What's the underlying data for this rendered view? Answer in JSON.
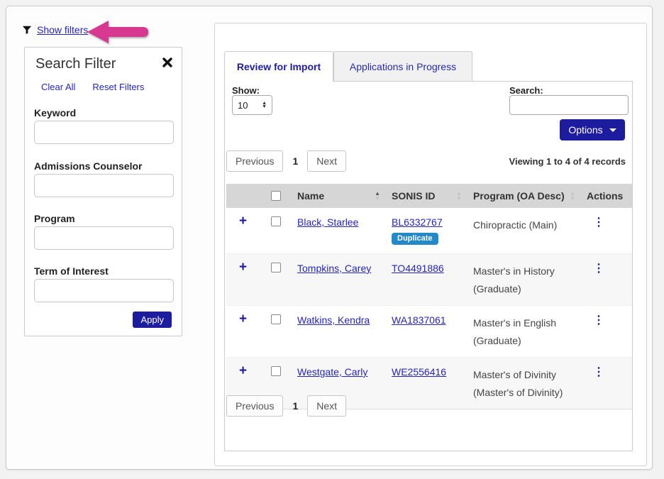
{
  "header": {
    "show_filters": "Show filters"
  },
  "filter_panel": {
    "title": "Search Filter",
    "clear_all": "Clear All",
    "reset_filters": "Reset Filters",
    "fields": [
      {
        "label": "Keyword",
        "value": ""
      },
      {
        "label": "Admissions Counselor",
        "value": ""
      },
      {
        "label": "Program",
        "value": ""
      },
      {
        "label": "Term of Interest",
        "value": ""
      }
    ],
    "apply": "Apply"
  },
  "tabs": {
    "review": "Review for Import",
    "in_progress": "Applications in Progress"
  },
  "toolbar": {
    "show_label": "Show:",
    "page_size": "10",
    "search_label": "Search:",
    "search_value": "",
    "options": "Options"
  },
  "pagination": {
    "previous": "Previous",
    "page": "1",
    "next": "Next"
  },
  "summary": {
    "viewing": "Viewing 1 to 4 of 4 records"
  },
  "table": {
    "headers": {
      "name": "Name",
      "sonis_id": "SONIS ID",
      "program": "Program (OA Desc)",
      "actions": "Actions"
    },
    "rows": [
      {
        "name": "Black, Starlee",
        "sonis_id": "BL6332767",
        "badge": "Duplicate",
        "program_line1": "Chiropractic (Main)",
        "program_line2": ""
      },
      {
        "name": "Tompkins, Carey",
        "sonis_id": "TO4491886",
        "program_line1": "Master's in History",
        "program_line2": "(Graduate)"
      },
      {
        "name": "Watkins, Kendra",
        "sonis_id": "WA1837061",
        "program_line1": "Master's in English",
        "program_line2": "(Graduate)"
      },
      {
        "name": "Westgate, Carly",
        "sonis_id": "WE2556416",
        "program_line1": "Master's of Divinity",
        "program_line2": "(Master's of Divinity)"
      }
    ]
  },
  "colors": {
    "accent_navy": "#1e1c9e",
    "link_blue": "#2424bb",
    "arrow_pink": "#d6398f",
    "badge_blue": "#2389c9",
    "table_header_gray": "#d6d6d6"
  }
}
